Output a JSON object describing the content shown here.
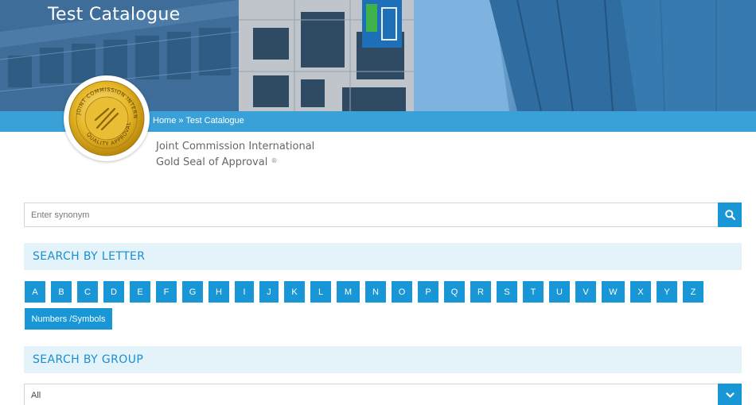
{
  "hero": {
    "title": "Test Catalogue"
  },
  "breadcrumb": {
    "home": "Home",
    "separator": "»",
    "current": "Test Catalogue"
  },
  "seal": {
    "ring_text": "JOINT COMMISSION INTERNATIONAL · QUALITY APPROVAL",
    "icon": "jci-gold-seal-icon"
  },
  "accreditation": {
    "line1": "Joint Commission International",
    "line2": "Gold Seal of Approval",
    "mark": "®"
  },
  "search": {
    "placeholder": "Enter synonym",
    "value": "",
    "button_icon": "search-icon"
  },
  "search_by_letter": {
    "heading": "SEARCH BY LETTER",
    "letters": [
      "A",
      "B",
      "C",
      "D",
      "E",
      "F",
      "G",
      "H",
      "I",
      "J",
      "K",
      "L",
      "M",
      "N",
      "O",
      "P",
      "Q",
      "R",
      "S",
      "T",
      "U",
      "V",
      "W",
      "X",
      "Y",
      "Z"
    ],
    "numbers_label": "Numbers /Symbols"
  },
  "search_by_group": {
    "heading": "SEARCH BY GROUP",
    "selected": "All",
    "arrow_icon": "chevron-down-icon"
  },
  "colors": {
    "accent": "#1896d6",
    "breadcrumb_bar": "#3aa0d8",
    "section_bg": "#e4f2fa",
    "heading_text": "#1a8fcf",
    "gold": "#e6b628"
  }
}
